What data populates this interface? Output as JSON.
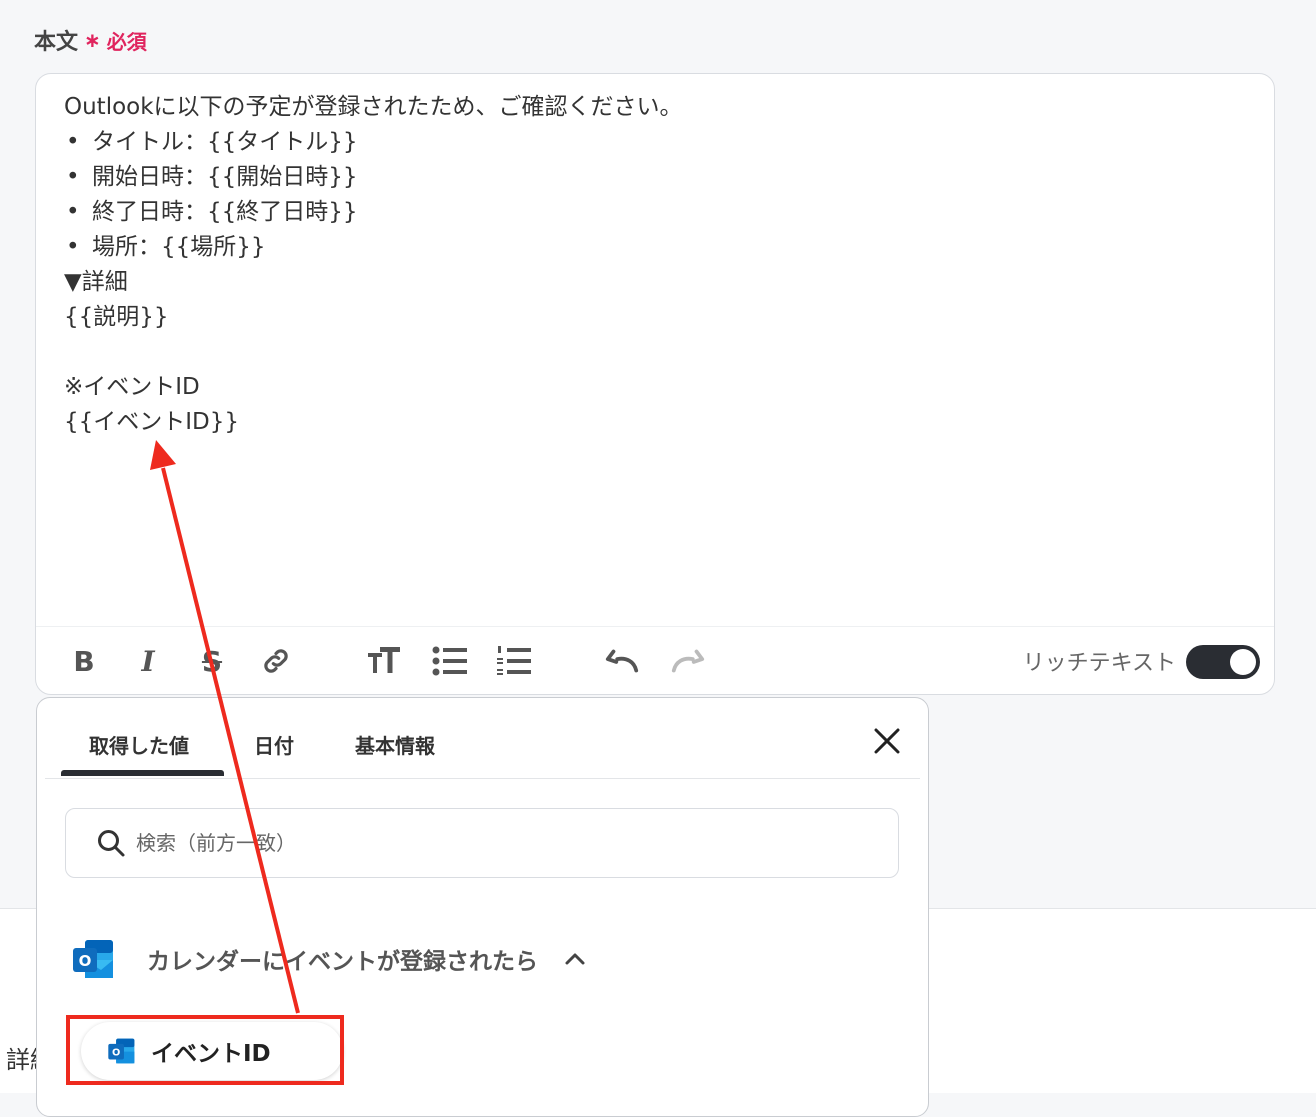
{
  "field": {
    "label": "本文",
    "required_mark": "∗",
    "required_text": "必須"
  },
  "editor": {
    "lines": [
      {
        "text": "Outlookに以下の予定が登録されたため、ご確認ください。",
        "bullet": false
      },
      {
        "text": "タイトル：{{タイトル}}",
        "bullet": true
      },
      {
        "text": "開始日時：{{開始日時}}",
        "bullet": true
      },
      {
        "text": "終了日時：{{終了日時}}",
        "bullet": true
      },
      {
        "text": "場所：{{場所}}",
        "bullet": true
      },
      {
        "text": "▼詳細",
        "bullet": false
      },
      {
        "text": "{{説明}}",
        "bullet": false
      },
      {
        "text": "",
        "bullet": false
      },
      {
        "text": "※イベントID",
        "bullet": false
      },
      {
        "text": "{{イベントID}}",
        "bullet": false
      }
    ]
  },
  "toolbar": {
    "bold_label": "B",
    "italic_label": "I",
    "strike_label": "S",
    "icons": [
      "bold-icon",
      "italic-icon",
      "strikethrough-icon",
      "link-icon",
      "text-size-icon",
      "bullet-list-icon",
      "numbered-list-icon",
      "undo-icon",
      "redo-icon"
    ],
    "rich_text_label": "リッチテキスト",
    "rich_text_enabled": true
  },
  "popup": {
    "tabs": [
      {
        "label": "取得した値",
        "active": true
      },
      {
        "label": "日付",
        "active": false
      },
      {
        "label": "基本情報",
        "active": false
      }
    ],
    "search_placeholder": "検索（前方一致）",
    "section_title": "カレンダーにイベントが登録されたら",
    "item_label": "イベントID"
  },
  "background": {
    "side_label": "詳細"
  },
  "colors": {
    "required": "#e0245e",
    "annotation": "#ee2a1e",
    "toggle_on": "#2a2d33",
    "outlook_blue": "#0f6cbd"
  }
}
